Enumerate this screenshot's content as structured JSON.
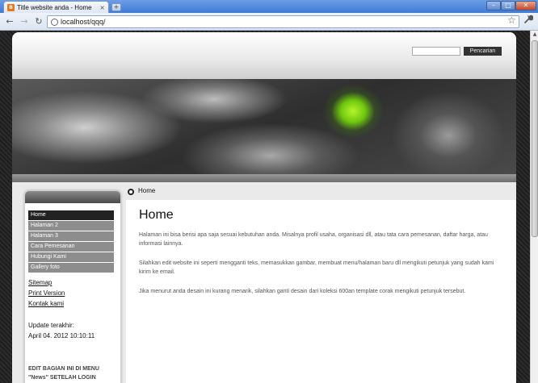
{
  "browser": {
    "tab_title": "Title website anda - Home",
    "tab_favicon": "blogger",
    "tab_close": "×",
    "new_tab": "+",
    "url": "localhost/qqq/",
    "window_buttons": {
      "minimize": "–",
      "maximize": "□",
      "close": "✕"
    },
    "nav": {
      "back": "←",
      "forward": "→",
      "reload": "↻"
    },
    "star": "☆",
    "wrench": "🔧"
  },
  "header": {
    "search_placeholder": "",
    "search_button": "Pencarian"
  },
  "breadcrumb": {
    "current": "Home"
  },
  "sidebar": {
    "menu": [
      {
        "label": "Home",
        "active": true
      },
      {
        "label": "Halaman 2",
        "active": false
      },
      {
        "label": "Halaman 3",
        "active": false
      },
      {
        "label": "Cara Pemesanan",
        "active": false
      },
      {
        "label": "Hubungi Kami",
        "active": false
      },
      {
        "label": "Gallery foto",
        "active": false
      }
    ],
    "links": [
      "Sitemap",
      "Print Version",
      "Kontak kami"
    ],
    "update_label": "Update terakhir:",
    "update_value": "April 04. 2012 10:10:11",
    "edit_note": "EDIT BAGIAN INI DI MENU \"News\" SETELAH LOGIN"
  },
  "main": {
    "title": "Home",
    "paragraphs": [
      "Halaman ini bisa berisi apa saja sesuai kebutuhan anda. Misalnya profil usaha, organisasi dll, atau tata cara pemesanan, daftar harga, atau informasi lainnya.",
      "Silahkan edit website ini seperti mengganti teks, memasukkan gambar, membuat menu/halaman baru dll mengikuti petunjuk yang sudah kami kirim ke email.",
      "Jika menurut anda desain ini kurang menarik, silahkan ganti desain dari koleksi 600an template corak mengikuti petunjuk tersebut."
    ]
  },
  "colors": {
    "accent_green": "#7ed321",
    "menu_active": "#222222",
    "menu_item": "#8d8d8d"
  }
}
